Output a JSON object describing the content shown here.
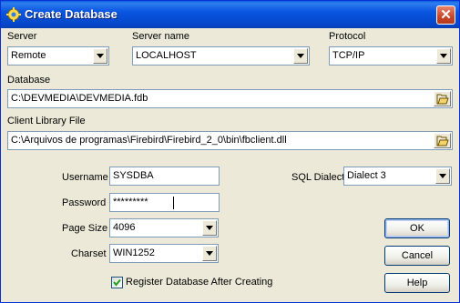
{
  "window": {
    "title": "Create Database",
    "close_glyph": "✕",
    "icon": "database-gear-icon"
  },
  "labels": {
    "server": "Server",
    "server_name": "Server name",
    "protocol": "Protocol",
    "database": "Database",
    "client_library": "Client Library File",
    "username": "Username",
    "password": "Password",
    "page_size": "Page Size",
    "charset": "Charset",
    "sql_dialect": "SQL Dialect"
  },
  "fields": {
    "server": "Remote",
    "server_name": "LOCALHOST",
    "protocol": "TCP/IP",
    "database": "C:\\DEVMEDIA\\DEVMEDIA.fdb",
    "client_library": "C:\\Arquivos de programas\\Firebird\\Firebird_2_0\\bin\\fbclient.dll",
    "username": "SYSDBA",
    "password": "*********",
    "page_size": "4096",
    "charset": "WIN1252",
    "sql_dialect": "Dialect 3"
  },
  "checkbox": {
    "label": "Register Database After Creating",
    "checked": true
  },
  "buttons": {
    "ok": "OK",
    "cancel": "Cancel",
    "help": "Help"
  },
  "icons": {
    "dropdown": "chevron-down-icon",
    "browse": "open-folder-icon"
  },
  "colors": {
    "titlebar": "#0a55e0",
    "dialog_bg": "#ece9d8",
    "field_border": "#7f9db9",
    "close_button": "#c8452a"
  }
}
